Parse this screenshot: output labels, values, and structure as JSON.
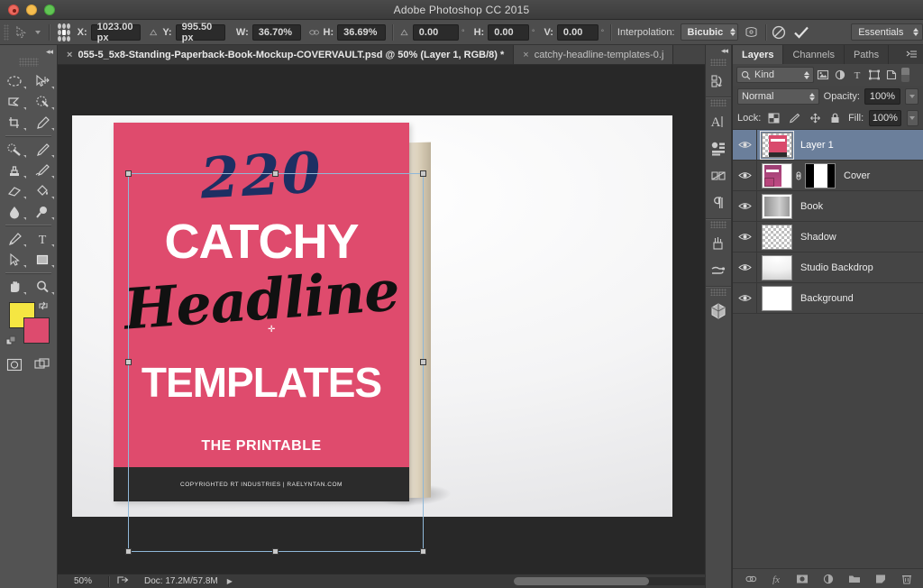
{
  "window": {
    "title": "Adobe Photoshop CC 2015",
    "controls": [
      "close",
      "minimize",
      "zoom"
    ]
  },
  "options_bar": {
    "tool": "move-tool",
    "fields": [
      {
        "label": "X:",
        "value": "1023.00 px",
        "name": "x-field"
      },
      {
        "label": "Y:",
        "value": "995.50 px",
        "name": "y-field"
      },
      {
        "label": "W:",
        "value": "36.70%",
        "name": "w-field"
      },
      {
        "label": "H:",
        "value": "36.69%",
        "name": "h-field"
      }
    ],
    "angle": {
      "value": "0.00",
      "unit": "°"
    },
    "skew_h": {
      "label": "H:",
      "value": "0.00",
      "unit": "°"
    },
    "skew_v": {
      "label": "V:",
      "value": "0.00",
      "unit": "°"
    },
    "interpolation": {
      "label": "Interpolation:",
      "value": "Bicubic"
    },
    "workspace": "Essentials",
    "cancel_label": "cancel-transform",
    "commit_label": "commit-transform"
  },
  "toolbar": {
    "tools": [
      "marquee-tool",
      "move-tool",
      "lasso-tool",
      "quick-selection-tool",
      "crop-tool",
      "eyedropper-tool",
      "spot-healing-brush-tool",
      "brush-tool",
      "clone-stamp-tool",
      "history-brush-tool",
      "eraser-tool",
      "paint-bucket-tool",
      "blur-tool",
      "dodge-tool",
      "pen-tool",
      "type-tool",
      "path-selection-tool",
      "rectangle-tool",
      "hand-tool",
      "zoom-tool"
    ],
    "foreground_color": "#f5e642",
    "background_color": "#dd4b6e",
    "bottom_tools": [
      "quick-mask-tool",
      "screen-mode-tool"
    ]
  },
  "tabs": {
    "items": [
      {
        "label": "055-5_5x8-Standing-Paperback-Book-Mockup-COVERVAULT.psd @ 50% (Layer 1, RGB/8) *",
        "active": true
      },
      {
        "label": "catchy-headline-templates-0.j",
        "active": false
      }
    ],
    "overflow": "»"
  },
  "canvas": {
    "cover": {
      "number": "220",
      "line1": "CATCHY",
      "line2": "Headline",
      "line3": "TEMPLATES",
      "subtitle": "THE PRINTABLE",
      "footer": "COPYRIGHTED RT INDUSTRIES | RAELYNTAN.COM",
      "pink": "#df4b6e",
      "navy": "#1d2f63",
      "spine": "#8f4a7d"
    },
    "selection": "free-transform-bounding-box"
  },
  "status_bar": {
    "zoom": "50%",
    "doc": "Doc: 17.2M/57.8M"
  },
  "right_rail": {
    "icons": [
      "history-icon",
      "character-icon",
      "properties-icon",
      "3d-transform-icon",
      "paragraph-icon",
      "adjustments-icon",
      "styles-icon",
      "3d-panel-icon"
    ]
  },
  "layers_panel": {
    "tabs": [
      {
        "label": "Layers",
        "active": true
      },
      {
        "label": "Channels",
        "active": false
      },
      {
        "label": "Paths",
        "active": false
      }
    ],
    "filter": {
      "kind": "Kind",
      "icons": [
        "pixel-filter-icon",
        "adjustment-filter-icon",
        "type-filter-icon",
        "shape-filter-icon",
        "smart-object-filter-icon"
      ]
    },
    "blend_mode": "Normal",
    "opacity_label": "Opacity:",
    "opacity_value": "100%",
    "lock_label": "Lock:",
    "lock_icons": [
      "lock-transparent-pixels-icon",
      "lock-image-pixels-icon",
      "lock-position-icon",
      "lock-all-icon"
    ],
    "fill_label": "Fill:",
    "fill_value": "100%",
    "layers": [
      {
        "name": "Layer 1",
        "selected": true,
        "visible": true,
        "kind": "transparent",
        "has_mask": false
      },
      {
        "name": "Cover",
        "selected": false,
        "visible": true,
        "kind": "cover",
        "has_mask": true
      },
      {
        "name": "Book",
        "selected": false,
        "visible": true,
        "kind": "book",
        "has_mask": false
      },
      {
        "name": "Shadow",
        "selected": false,
        "visible": true,
        "kind": "checker",
        "has_mask": false
      },
      {
        "name": "Studio Backdrop",
        "selected": false,
        "visible": true,
        "kind": "studio",
        "has_mask": false
      },
      {
        "name": "Background",
        "selected": false,
        "visible": true,
        "kind": "white",
        "has_mask": false
      }
    ],
    "footer_icons": [
      "link-layers-icon",
      "layer-styles-icon",
      "add-mask-icon",
      "adjustment-layer-icon",
      "new-group-icon",
      "new-layer-icon",
      "delete-layer-icon"
    ]
  }
}
